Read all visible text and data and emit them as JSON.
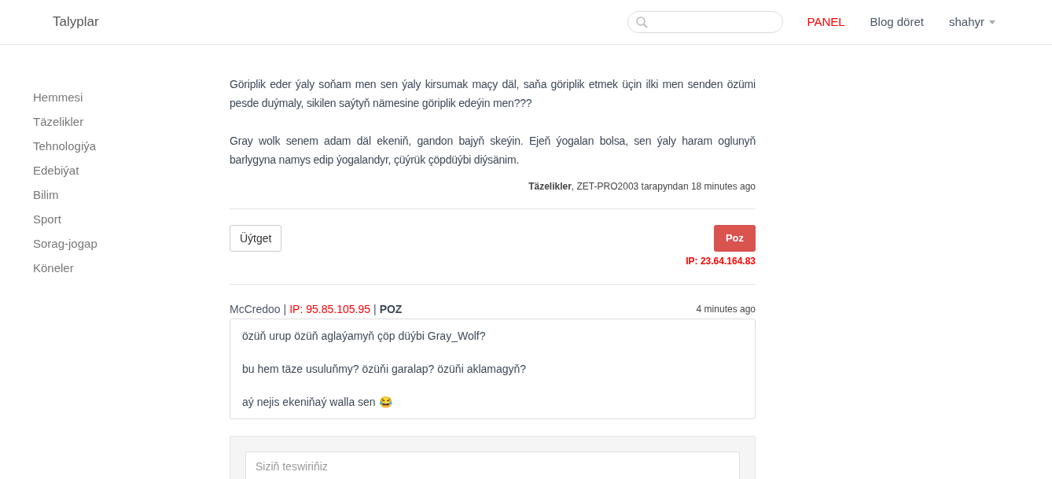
{
  "navbar": {
    "brand": "Talyplar",
    "links": [
      {
        "label": "PANEL",
        "kind": "highlight"
      },
      {
        "label": "Blog döret",
        "kind": "plain"
      },
      {
        "label": "shahyr",
        "kind": "dropdown"
      }
    ]
  },
  "sidebar": {
    "items": [
      "Hemmesi",
      "Täzelikler",
      "Tehnologiýa",
      "Edebiýat",
      "Bilim",
      "Sport",
      "Sorag-jogap",
      "Köneler"
    ]
  },
  "post": {
    "paragraphs": [
      "Göriplik eder ýaly soňam men sen ýaly kirsumak maçy däl, saňa göriplik etmek üçin ilki men senden özümi pesde duýmaly, sikilen saýtyň nämesine göriplik edeýin men???",
      "Gray wolk senem adam däl ekeniň, gandon bajyň skeýin. Ejeň ýogalan bolsa, sen ýaly haram oglunyň barlygyna namys edip ýogalandyr, çüýrük çöpdüýbi diýsänim."
    ],
    "meta": "**Täzelikler**, ZET-PRO2003 tarapyndan 18 minutes ago",
    "edit_button": "Üýtget",
    "delete_button": "Poz",
    "ip": "IP: 23.64.164.83"
  },
  "comments": [
    {
      "author": "McCredoo",
      "separator_1": "|",
      "ip": "IP: 95.85.105.95",
      "separator_2": "|",
      "delete_link": "POZ",
      "time": "4 minutes ago",
      "lines": [
        "özüň urup özüň aglaýamyň çöp düýbi Gray_Wolf?",
        "bu hem täze usuluňmy? özüňi garalap? özüňi aklamagyň?",
        "aý nejis ekeniňaý walla sen 😂"
      ]
    }
  ],
  "comment_form": {
    "placeholder": "Siziň teswiriňiz"
  }
}
